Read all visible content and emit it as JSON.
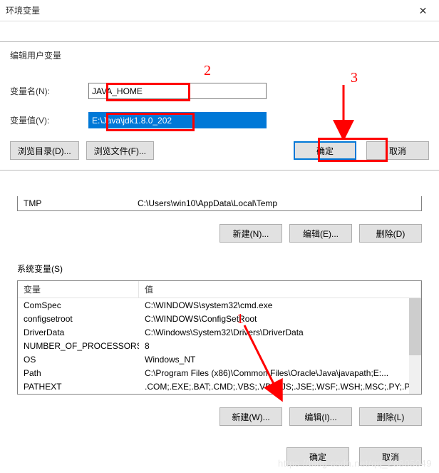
{
  "outer": {
    "title": "环境变量"
  },
  "edit_dialog": {
    "title": "编辑用户变量",
    "name_label": "变量名(N):",
    "name_value": "JAVA_HOME",
    "value_label": "变量值(V):",
    "value_value": "E:\\Java\\jdk1.8.0_202",
    "browse_dir": "浏览目录(D)...",
    "browse_file": "浏览文件(F)...",
    "ok": "确定",
    "cancel": "取消"
  },
  "user_partial": {
    "tmp_name": "TMP",
    "tmp_value": "C:\\Users\\win10\\AppData\\Local\\Temp",
    "new_btn": "新建(N)...",
    "edit_btn": "编辑(E)...",
    "delete_btn": "删除(D)"
  },
  "sys": {
    "label": "系统变量(S)",
    "header_var": "变量",
    "header_val": "值",
    "rows": [
      {
        "name": "ComSpec",
        "value": "C:\\WINDOWS\\system32\\cmd.exe"
      },
      {
        "name": "configsetroot",
        "value": "C:\\WINDOWS\\ConfigSetRoot"
      },
      {
        "name": "DriverData",
        "value": "C:\\Windows\\System32\\Drivers\\DriverData"
      },
      {
        "name": "NUMBER_OF_PROCESSORS",
        "value": "8"
      },
      {
        "name": "OS",
        "value": "Windows_NT"
      },
      {
        "name": "Path",
        "value": "C:\\Program Files (x86)\\Common Files\\Oracle\\Java\\javapath;E:..."
      },
      {
        "name": "PATHEXT",
        "value": ".COM;.EXE;.BAT;.CMD;.VBS;.VBE;.JS;.JSE;.WSF;.WSH;.MSC;.PY;.P..."
      }
    ],
    "new_btn": "新建(W)...",
    "edit_btn": "编辑(I)...",
    "delete_btn": "删除(L)"
  },
  "footer": {
    "ok": "确定",
    "cancel": "取消"
  },
  "annotations": {
    "a1": "1",
    "a2": "2",
    "a3": "3"
  },
  "watermark": "https://blog.csdn.net/qq_28805049"
}
